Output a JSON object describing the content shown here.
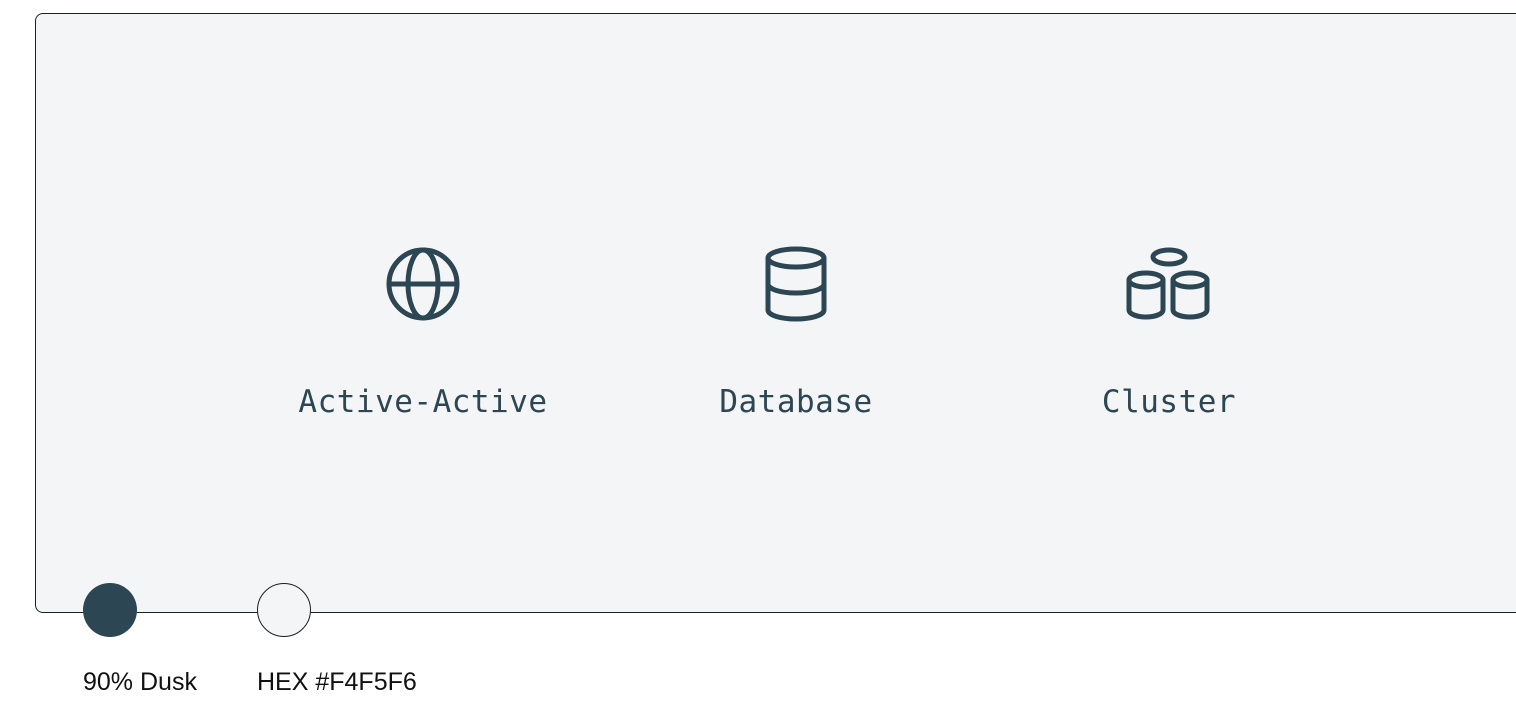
{
  "colors": {
    "dusk": "#2d4654",
    "card_background": "#F4F5F6"
  },
  "items": [
    {
      "icon": "globe-icon",
      "label": "Active-Active"
    },
    {
      "icon": "database-icon",
      "label": "Database"
    },
    {
      "icon": "cluster-icon",
      "label": "Cluster"
    }
  ],
  "swatches": [
    {
      "label": "90% Dusk"
    },
    {
      "label": "HEX #F4F5F6"
    }
  ]
}
